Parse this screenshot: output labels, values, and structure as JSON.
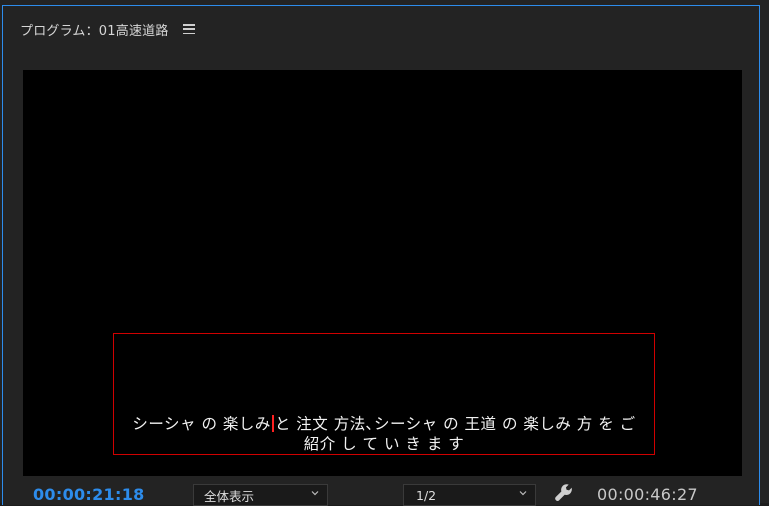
{
  "panel": {
    "title": "プログラム：01高速道路",
    "menu_icon": "hamburger-menu-icon"
  },
  "caption": {
    "line1_part1": "シーシャ の 楽しみ",
    "line1_part2": "と 注文 方法､シーシャ の 王道 の 楽しみ 方 を ご",
    "line2": "紹介 し て い き ま す"
  },
  "controls": {
    "current_timecode": "00:00:21:18",
    "zoom_value": "全体表示",
    "resolution_value": "1/2",
    "settings_icon": "wrench-icon",
    "duration_timecode": "00:00:46:27"
  },
  "colors": {
    "accent": "#2d8ceb",
    "selection_box": "#d00000",
    "cursor": "#ff2020",
    "panel_bg": "#232323",
    "video_bg": "#000000"
  }
}
